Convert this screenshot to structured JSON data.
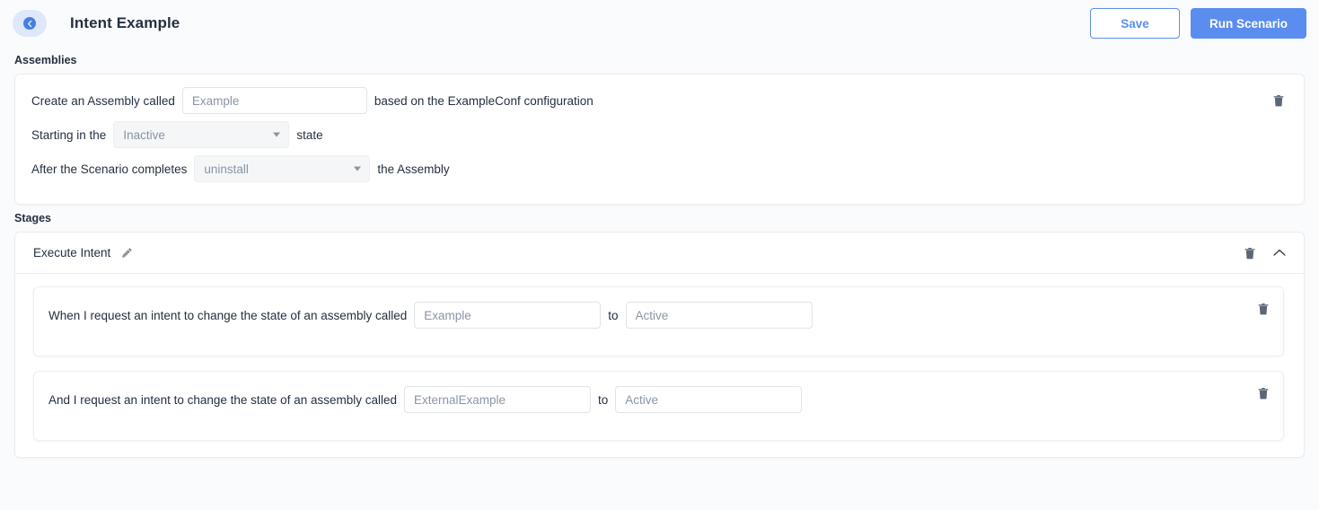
{
  "header": {
    "back_icon": "back-arrow-icon",
    "title": "Intent Example",
    "save_label": "Save",
    "run_label": "Run Scenario",
    "primary_color": "#5b8def"
  },
  "assemblies": {
    "section_label": "Assemblies",
    "rows": [
      {
        "prefix": "Create an Assembly called",
        "input_placeholder": "Example",
        "input_value": "",
        "suffix": "based on the ExampleConf configuration"
      },
      {
        "prefix": "Starting in the",
        "select_value": "Inactive",
        "suffix": "state"
      },
      {
        "prefix": "After the Scenario completes",
        "select_value": "uninstall",
        "suffix": "the Assembly"
      }
    ],
    "delete_icon": "trash-icon"
  },
  "stages": {
    "section_label": "Stages",
    "stage": {
      "name": "Execute Intent",
      "edit_icon": "pencil-icon",
      "delete_icon": "trash-icon",
      "collapse_icon": "chevron-up-icon",
      "steps": [
        {
          "prefix": "When I request an intent to change the state of an assembly called",
          "assembly_placeholder": "Example",
          "assembly_value": "",
          "connector": "to",
          "state_placeholder": "Active",
          "state_value": "",
          "delete_icon": "trash-icon"
        },
        {
          "prefix": "And I request an intent to change the state of an assembly called",
          "assembly_placeholder": "ExternalExample",
          "assembly_value": "",
          "connector": "to",
          "state_placeholder": "Active",
          "state_value": "",
          "delete_icon": "trash-icon"
        }
      ]
    }
  }
}
